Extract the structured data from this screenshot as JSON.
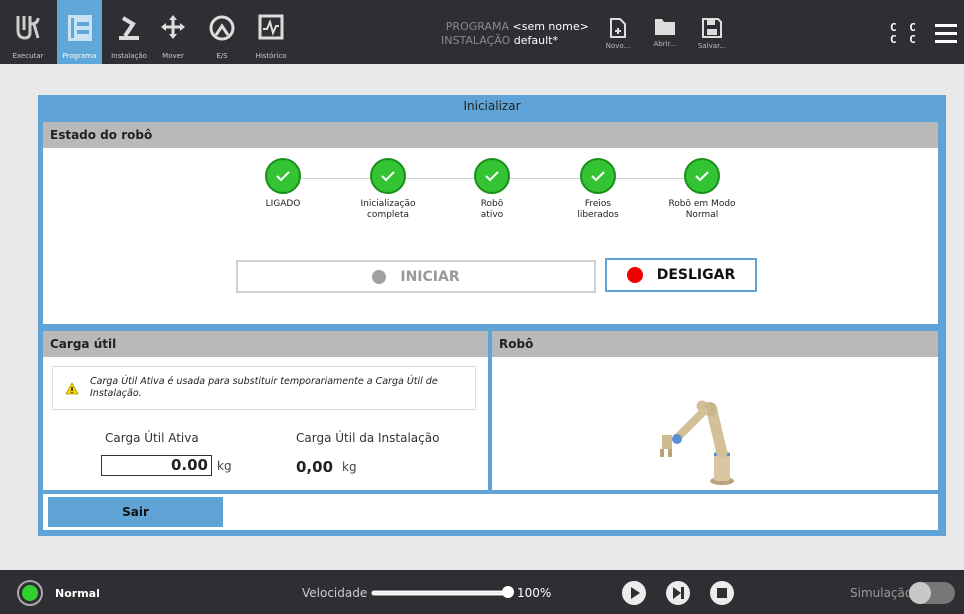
{
  "nav": {
    "items": [
      {
        "label": "Executar",
        "icon": "ur-logo-icon"
      },
      {
        "label": "Programa",
        "icon": "program-icon"
      },
      {
        "label": "Instalação",
        "icon": "installation-icon"
      },
      {
        "label": "Mover",
        "icon": "move-icon"
      },
      {
        "label": "E/S",
        "icon": "io-icon"
      },
      {
        "label": "Histórico",
        "icon": "log-icon"
      }
    ],
    "active": "Programa"
  },
  "program": {
    "program_label": "PROGRAMA",
    "program_value": "<sem nome>",
    "installation_label": "INSTALAÇÃO",
    "installation_value": "default*"
  },
  "file_buttons": {
    "new": "Novo...",
    "open": "Abrir...",
    "save": "Salvar..."
  },
  "dialog": {
    "title": "Inicializar",
    "robot_state": {
      "header": "Estado do robô",
      "steps": [
        {
          "label": "LIGADO"
        },
        {
          "label": "Inicialização completa"
        },
        {
          "label": "Robô ativo"
        },
        {
          "label": "Freios liberados"
        },
        {
          "label": "Robô em Modo Normal"
        }
      ],
      "start_button": "INICIAR",
      "shutdown_button": "DESLIGAR"
    },
    "payload": {
      "header": "Carga útil",
      "warning": "Carga Útil Ativa é usada para substituir temporariamente a Carga Útil de Instalação.",
      "active_label": "Carga Útil Ativa",
      "active_value": "0.00",
      "installation_label": "Carga Útil da Instalação",
      "installation_value": "0,00",
      "unit": "kg"
    },
    "robot": {
      "header": "Robô"
    },
    "exit_button": "Sair"
  },
  "bottom": {
    "status": "Normal",
    "speed_label": "Velocidade",
    "speed_value": "100%",
    "simulation_label": "Simulação"
  },
  "colors": {
    "accent": "#5fa3d7",
    "status_ok": "#33c333",
    "stop": "#e00000",
    "bar": "#2f2f33"
  }
}
